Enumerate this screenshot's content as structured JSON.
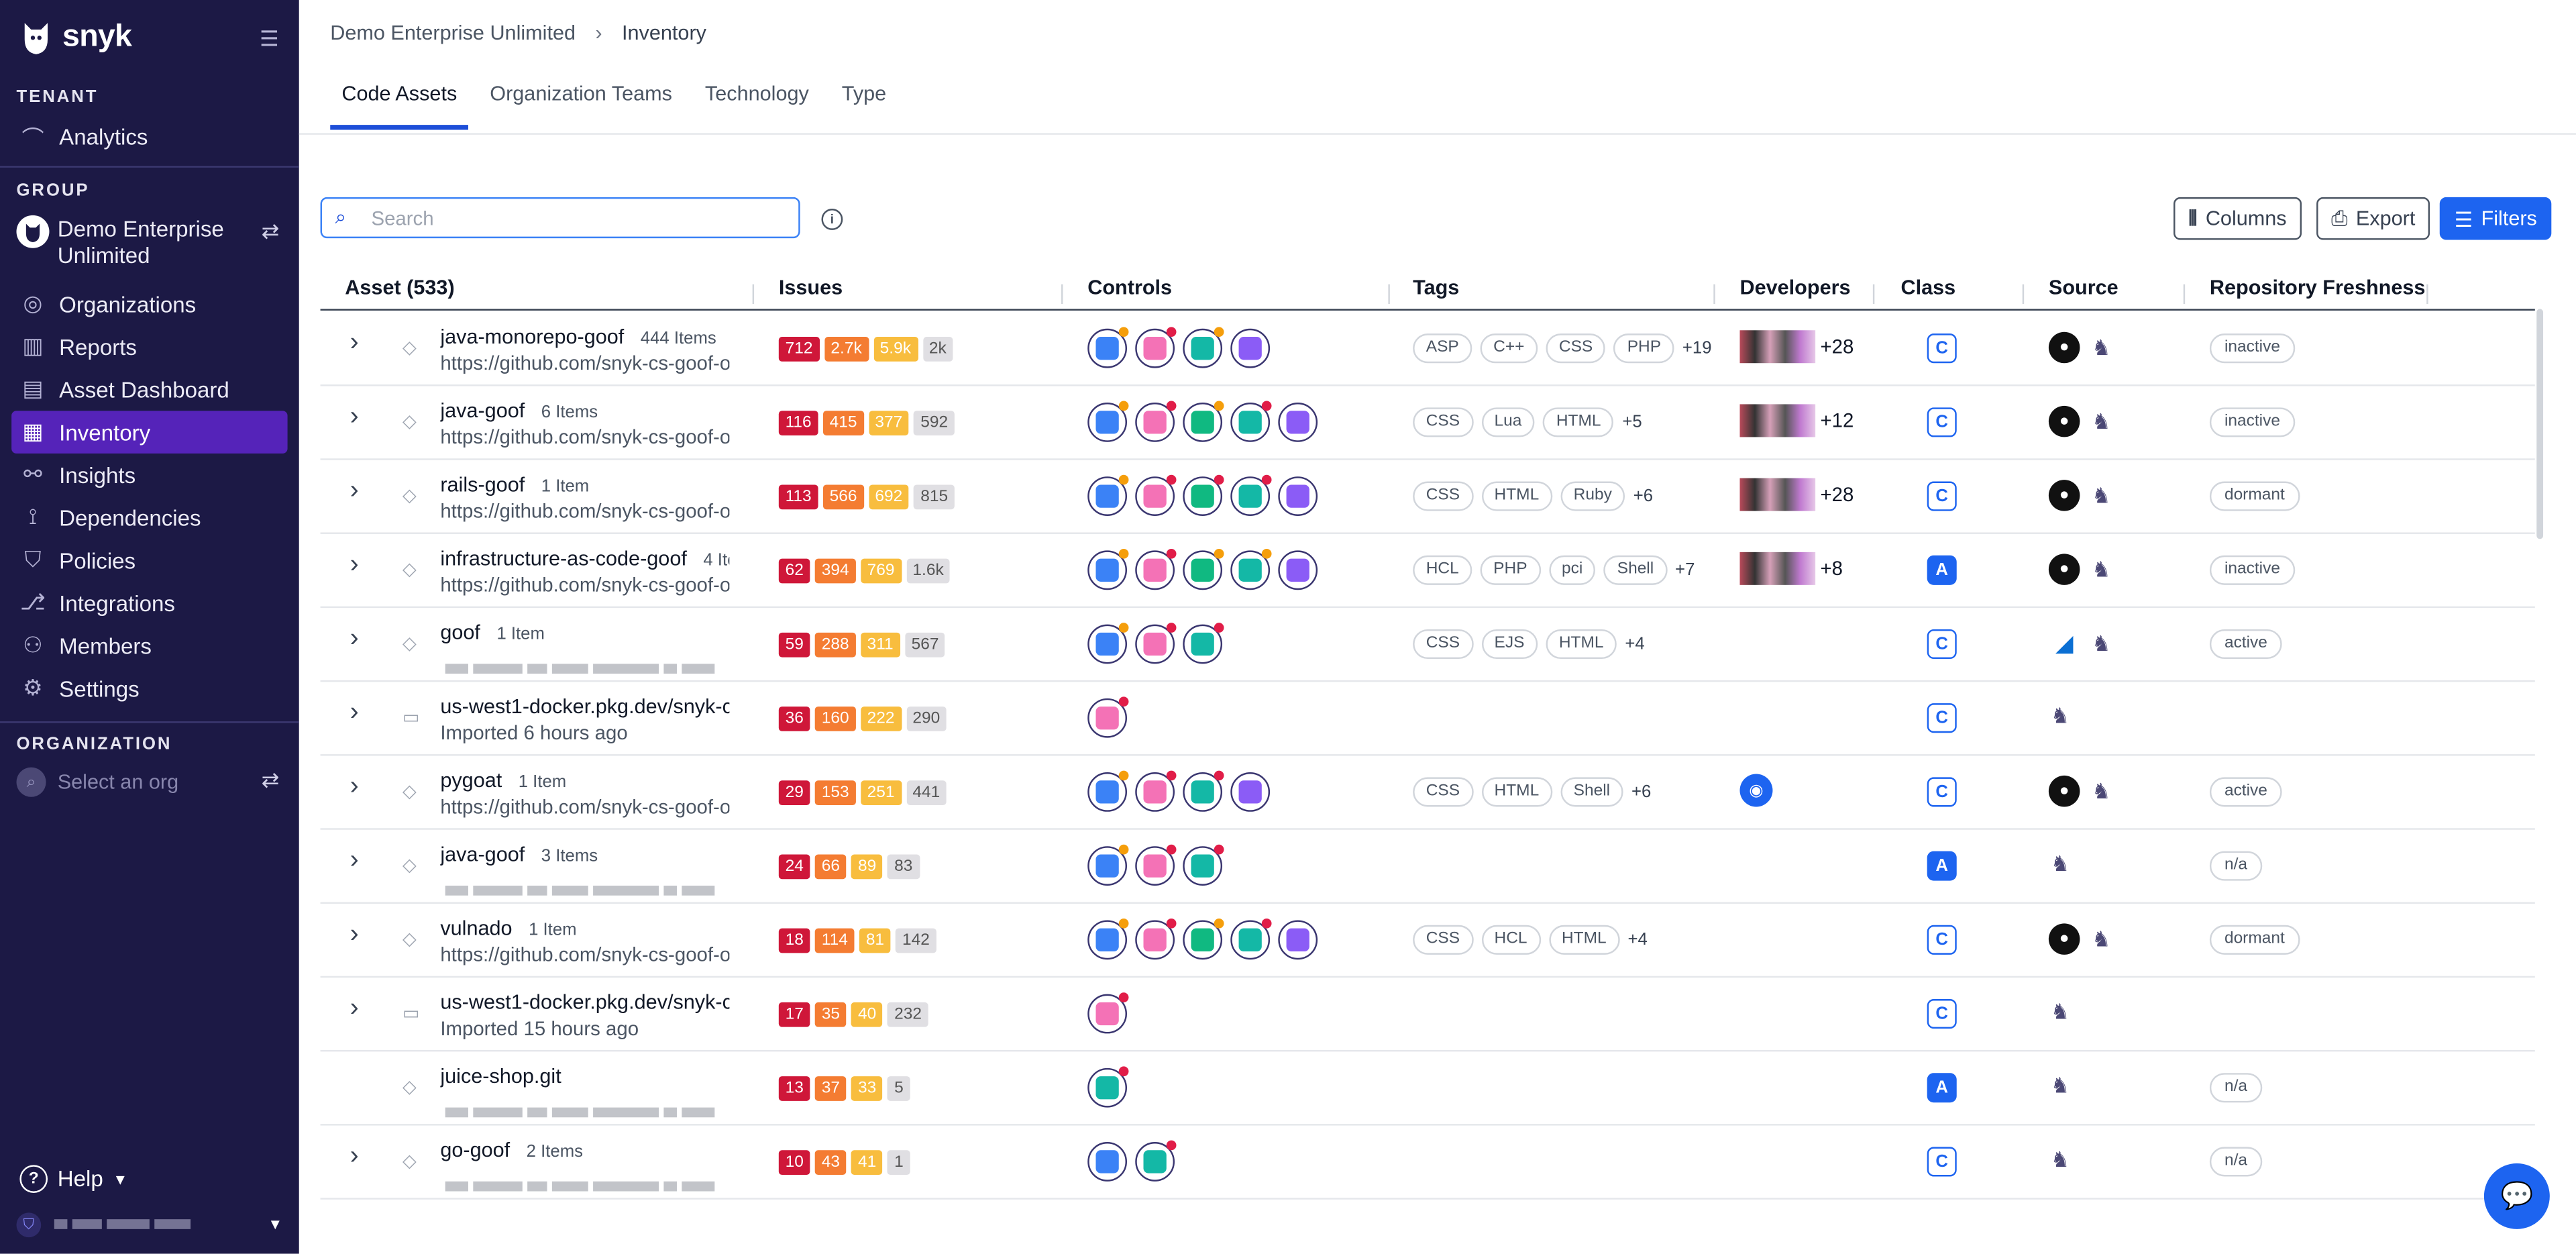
{
  "sidebar": {
    "logo": "snyk",
    "tenant_title": "TENANT",
    "analytics": "Analytics",
    "group_title": "GROUP",
    "group_name": "Demo Enterprise Unlimited",
    "nav": [
      "Organizations",
      "Reports",
      "Asset Dashboard",
      "Inventory",
      "Insights",
      "Dependencies",
      "Policies",
      "Integrations",
      "Members",
      "Settings"
    ],
    "active_item": "Inventory",
    "org_title": "ORGANIZATION",
    "org_placeholder": "Select an org",
    "help": "Help"
  },
  "breadcrumb": {
    "group": "Demo Enterprise Unlimited",
    "page": "Inventory"
  },
  "tabs": [
    "Code Assets",
    "Organization Teams",
    "Technology",
    "Type"
  ],
  "active_tab": "Code Assets",
  "search": {
    "placeholder": "Search"
  },
  "toolbar": {
    "columns": "Columns",
    "export": "Export",
    "filters": "Filters"
  },
  "columns": {
    "asset": "Asset (533)",
    "issues": "Issues",
    "controls": "Controls",
    "tags": "Tags",
    "developers": "Developers",
    "class": "Class",
    "source": "Source",
    "freshness": "Repository Freshness"
  },
  "colors": {
    "sidebar_bg": "#1c1945",
    "active_nav": "#5523b9",
    "primary": "#1d64f0",
    "critical": "#cf1739",
    "high": "#f47c32",
    "medium": "#f8bd3e",
    "low": "#e0dfe3"
  },
  "rows": [
    {
      "name": "java-monorepo-goof",
      "count": "444 Items",
      "sub": "https://github.com/snyk-cs-goof-o",
      "issues": [
        "712",
        "2.7k",
        "5.9k",
        "2k"
      ],
      "tags": [
        "ASP",
        "C++",
        "CSS",
        "PHP"
      ],
      "tags_more": "+19",
      "devs_more": "+28",
      "class": "C",
      "source": [
        "github",
        "snyk"
      ],
      "freshness": "inactive"
    },
    {
      "name": "java-goof",
      "count": "6 Items",
      "sub": "https://github.com/snyk-cs-goof-o",
      "issues": [
        "116",
        "415",
        "377",
        "592"
      ],
      "tags": [
        "CSS",
        "Lua",
        "HTML"
      ],
      "tags_more": "+5",
      "devs_more": "+12",
      "class": "C",
      "source": [
        "github",
        "snyk"
      ],
      "freshness": "inactive"
    },
    {
      "name": "rails-goof",
      "count": "1 Item",
      "sub": "https://github.com/snyk-cs-goof-o",
      "issues": [
        "113",
        "566",
        "692",
        "815"
      ],
      "tags": [
        "CSS",
        "HTML",
        "Ruby"
      ],
      "tags_more": "+6",
      "devs_more": "+28",
      "class": "C",
      "source": [
        "github",
        "snyk"
      ],
      "freshness": "dormant"
    },
    {
      "name": "infrastructure-as-code-goof",
      "count": "4 Ite",
      "sub": "https://github.com/snyk-cs-goof-o",
      "issues": [
        "62",
        "394",
        "769",
        "1.6k"
      ],
      "tags": [
        "HCL",
        "PHP",
        "pci",
        "Shell"
      ],
      "tags_more": "+7",
      "devs_more": "+8",
      "class": "A",
      "source": [
        "github",
        "snyk"
      ],
      "freshness": "inactive"
    },
    {
      "name": "goof",
      "count": "1 Item",
      "sub": "",
      "issues": [
        "59",
        "288",
        "311",
        "567"
      ],
      "tags": [
        "CSS",
        "EJS",
        "HTML"
      ],
      "tags_more": "+4",
      "devs_more": "",
      "class": "C",
      "source": [
        "azure",
        "snyk"
      ],
      "freshness": "active"
    },
    {
      "name": "us-west1-docker.pkg.dev/snyk-cx-",
      "count": "",
      "sub": "Imported 6 hours ago",
      "issues": [
        "36",
        "160",
        "222",
        "290"
      ],
      "tags": [],
      "tags_more": "",
      "devs_more": "",
      "class": "C",
      "source": [
        "snyk"
      ],
      "freshness": ""
    },
    {
      "name": "pygoat",
      "count": "1 Item",
      "sub": "https://github.com/snyk-cs-goof-o",
      "issues": [
        "29",
        "153",
        "251",
        "441"
      ],
      "tags": [
        "CSS",
        "HTML",
        "Shell"
      ],
      "tags_more": "+6",
      "devs_more": "",
      "class": "C",
      "source": [
        "github",
        "snyk"
      ],
      "freshness": "active"
    },
    {
      "name": "java-goof",
      "count": "3 Items",
      "sub": "",
      "issues": [
        "24",
        "66",
        "89",
        "83"
      ],
      "tags": [],
      "tags_more": "",
      "devs_more": "",
      "class": "A",
      "source": [
        "snyk"
      ],
      "freshness": "n/a"
    },
    {
      "name": "vulnado",
      "count": "1 Item",
      "sub": "https://github.com/snyk-cs-goof-o",
      "issues": [
        "18",
        "114",
        "81",
        "142"
      ],
      "tags": [
        "CSS",
        "HCL",
        "HTML"
      ],
      "tags_more": "+4",
      "devs_more": "",
      "class": "C",
      "source": [
        "github",
        "snyk"
      ],
      "freshness": "dormant"
    },
    {
      "name": "us-west1-docker.pkg.dev/snyk-cx-",
      "count": "",
      "sub": "Imported 15 hours ago",
      "issues": [
        "17",
        "35",
        "40",
        "232"
      ],
      "tags": [],
      "tags_more": "",
      "devs_more": "",
      "class": "C",
      "source": [
        "snyk"
      ],
      "freshness": ""
    },
    {
      "name": "juice-shop.git",
      "count": "",
      "sub": "",
      "issues": [
        "13",
        "37",
        "33",
        "5"
      ],
      "tags": [],
      "tags_more": "",
      "devs_more": "",
      "class": "A",
      "source": [
        "snyk"
      ],
      "freshness": "n/a"
    },
    {
      "name": "go-goof",
      "count": "2 Items",
      "sub": "",
      "issues": [
        "10",
        "43",
        "41",
        "1"
      ],
      "tags": [],
      "tags_more": "",
      "devs_more": "",
      "class": "C",
      "source": [
        "snyk"
      ],
      "freshness": "n/a"
    }
  ]
}
